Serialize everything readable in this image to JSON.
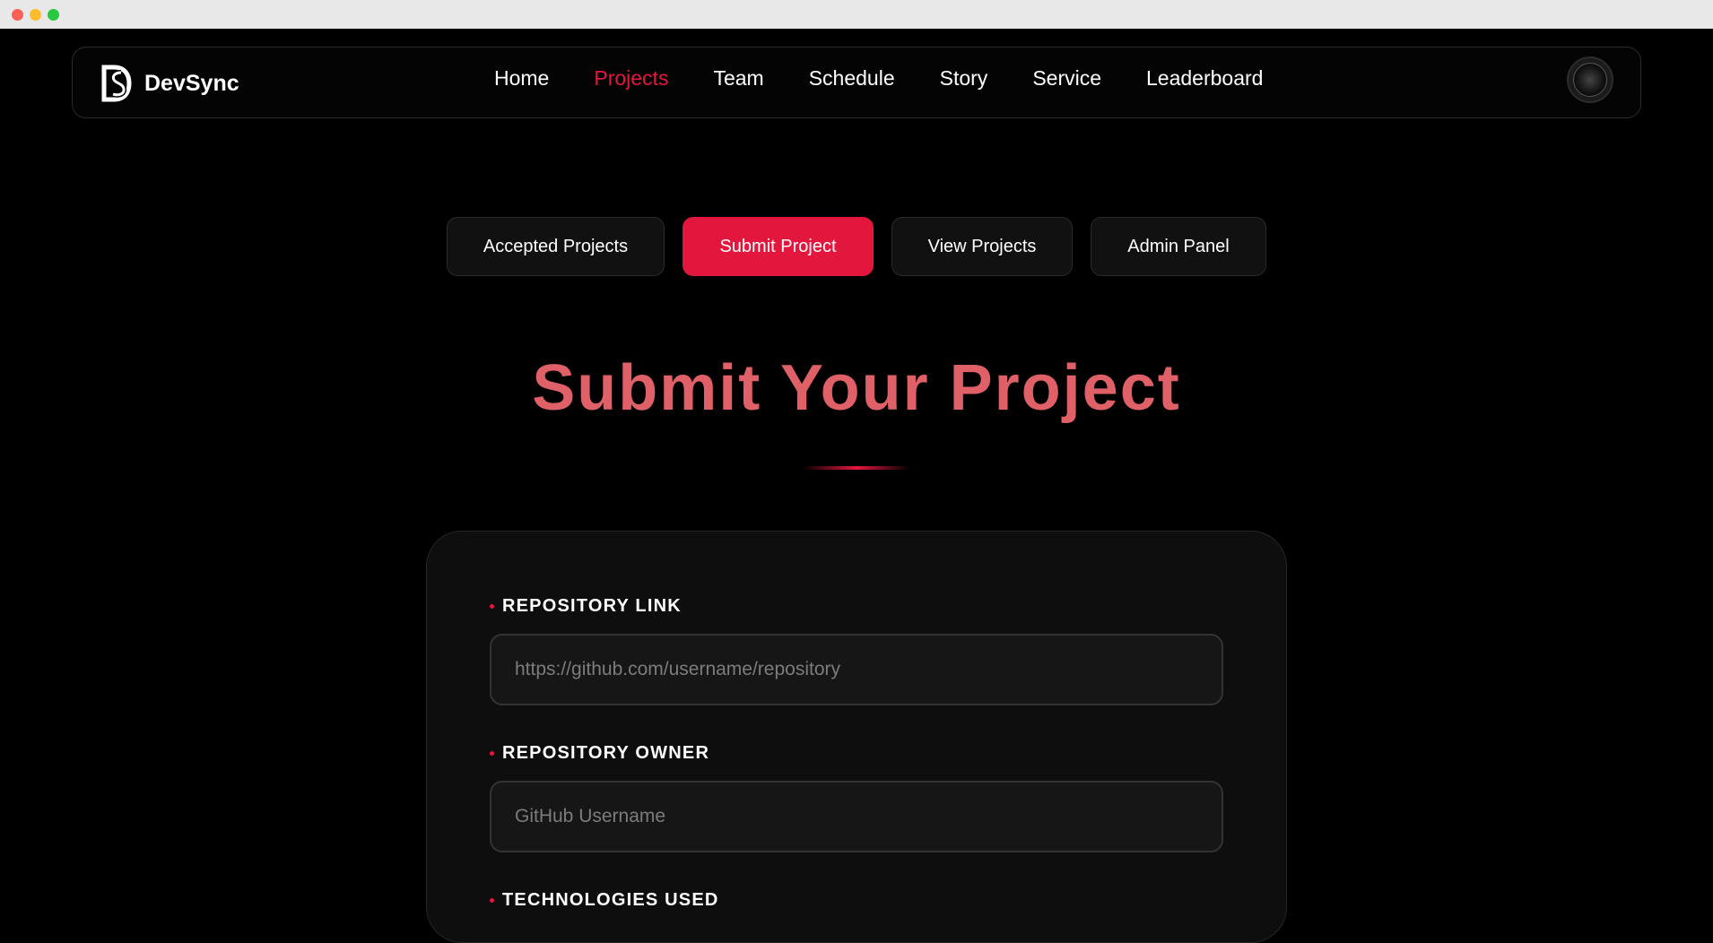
{
  "brand": {
    "name": "DevSync",
    "logo": "ds-logo-icon"
  },
  "nav": {
    "links": [
      {
        "label": "Home",
        "active": false
      },
      {
        "label": "Projects",
        "active": true
      },
      {
        "label": "Team",
        "active": false
      },
      {
        "label": "Schedule",
        "active": false
      },
      {
        "label": "Story",
        "active": false
      },
      {
        "label": "Service",
        "active": false
      },
      {
        "label": "Leaderboard",
        "active": false
      }
    ],
    "avatar": "user-avatar"
  },
  "tabs": [
    {
      "label": "Accepted Projects",
      "active": false
    },
    {
      "label": "Submit Project",
      "active": true
    },
    {
      "label": "View Projects",
      "active": false
    },
    {
      "label": "Admin Panel",
      "active": false
    }
  ],
  "page": {
    "title": "Submit Your Project"
  },
  "form": {
    "fields": [
      {
        "label": "REPOSITORY LINK",
        "placeholder": "https://github.com/username/repository",
        "value": ""
      },
      {
        "label": "REPOSITORY OWNER",
        "placeholder": "GitHub Username",
        "value": ""
      },
      {
        "label": "TECHNOLOGIES USED"
      }
    ]
  },
  "colors": {
    "accent": "#e3173e",
    "title": "#e06068",
    "background": "#000000"
  }
}
